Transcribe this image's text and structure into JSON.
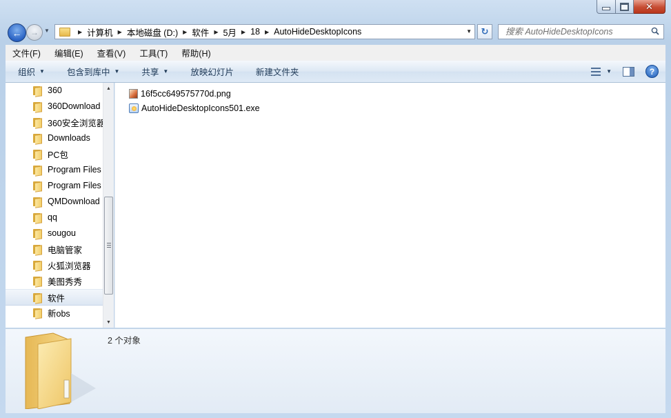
{
  "window": {
    "title_buttons": [
      "minimize",
      "maximize",
      "close"
    ]
  },
  "nav": {
    "breadcrumbs": [
      "计算机",
      "本地磁盘 (D:)",
      "软件",
      "5月",
      "18",
      "AutoHideDesktopIcons"
    ],
    "search_placeholder": "搜索 AutoHideDesktopIcons"
  },
  "menu": [
    "文件(F)",
    "编辑(E)",
    "查看(V)",
    "工具(T)",
    "帮助(H)"
  ],
  "commands": [
    {
      "label": "组织",
      "has_dropdown": true
    },
    {
      "label": "包含到库中",
      "has_dropdown": true
    },
    {
      "label": "共享",
      "has_dropdown": true
    },
    {
      "label": "放映幻灯片",
      "has_dropdown": false
    },
    {
      "label": "新建文件夹",
      "has_dropdown": false
    }
  ],
  "tree": [
    {
      "label": "360",
      "selected": false
    },
    {
      "label": "360Download",
      "selected": false
    },
    {
      "label": "360安全浏览器",
      "selected": false
    },
    {
      "label": "Downloads",
      "selected": false
    },
    {
      "label": "PC包",
      "selected": false
    },
    {
      "label": "Program Files",
      "selected": false
    },
    {
      "label": "Program Files",
      "selected": false
    },
    {
      "label": "QMDownload",
      "selected": false
    },
    {
      "label": "qq",
      "selected": false
    },
    {
      "label": "sougou",
      "selected": false
    },
    {
      "label": "电脑管家",
      "selected": false
    },
    {
      "label": "火狐浏览器",
      "selected": false
    },
    {
      "label": "美图秀秀",
      "selected": false
    },
    {
      "label": "软件",
      "selected": true
    },
    {
      "label": "新obs",
      "selected": false
    }
  ],
  "files": [
    {
      "name": "16f5cc649575770d.png",
      "icon": "png-file-icon"
    },
    {
      "name": "AutoHideDesktopIcons501.exe",
      "icon": "exe-file-icon"
    }
  ],
  "details": {
    "count_text": "2 个对象"
  },
  "colors": {
    "frame": "#c5d9ef",
    "command_bar": "#dde8f4",
    "close_button": "#c74d33"
  }
}
